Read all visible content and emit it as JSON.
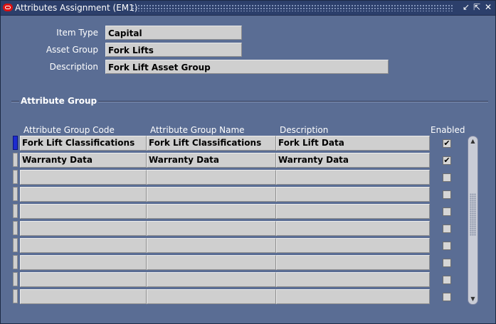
{
  "window": {
    "title": "Attributes Assignment (EM1)",
    "controls": [
      "↙",
      "⇱",
      "✕"
    ]
  },
  "header": {
    "item_type_label": "Item Type",
    "item_type_value": "Capital",
    "asset_group_label": "Asset Group",
    "asset_group_value": "Fork Lifts",
    "description_label": "Description",
    "description_value": "Fork Lift Asset Group"
  },
  "attribute_group": {
    "title": "Attribute Group",
    "columns": {
      "code": "Attribute Group Code",
      "name": "Attribute Group Name",
      "description": "Description",
      "enabled": "Enabled"
    },
    "rows": [
      {
        "code": "Fork Lift Classifications",
        "name": "Fork Lift Classifications",
        "description": "Fork Lift Data",
        "enabled": "✔"
      },
      {
        "code": "Warranty Data",
        "name": "Warranty Data",
        "description": "Warranty Data",
        "enabled": "✔"
      },
      {
        "code": "",
        "name": "",
        "description": "",
        "enabled": ""
      },
      {
        "code": "",
        "name": "",
        "description": "",
        "enabled": ""
      },
      {
        "code": "",
        "name": "",
        "description": "",
        "enabled": ""
      },
      {
        "code": "",
        "name": "",
        "description": "",
        "enabled": ""
      },
      {
        "code": "",
        "name": "",
        "description": "",
        "enabled": ""
      },
      {
        "code": "",
        "name": "",
        "description": "",
        "enabled": ""
      },
      {
        "code": "",
        "name": "",
        "description": "",
        "enabled": ""
      },
      {
        "code": "",
        "name": "",
        "description": "",
        "enabled": ""
      }
    ]
  },
  "scrollbar": {
    "up": "▲",
    "down": "▼"
  }
}
